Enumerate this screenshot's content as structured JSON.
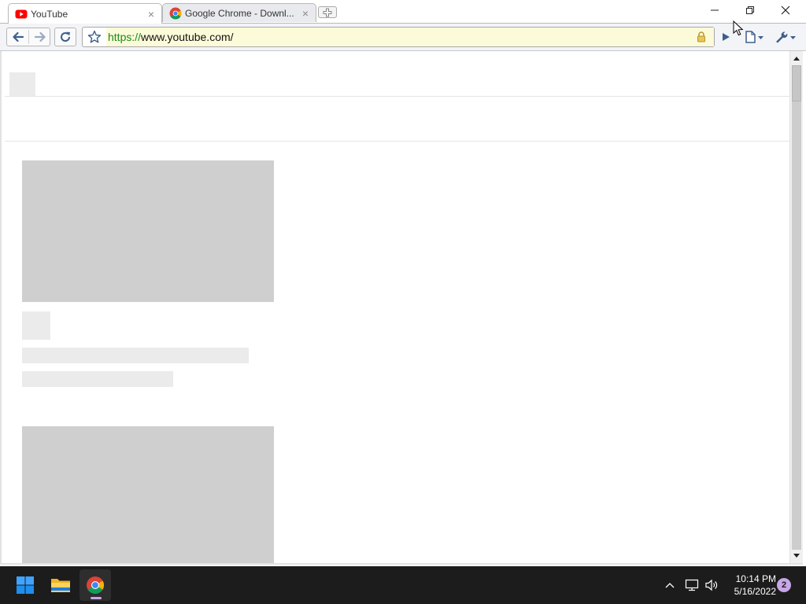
{
  "browser": {
    "tabs": [
      {
        "title": "YouTube",
        "favicon": "youtube-icon",
        "active": true
      },
      {
        "title": "Google Chrome - Downl...",
        "favicon": "chrome-icon",
        "active": false
      }
    ],
    "new_tab": "new-tab-icon",
    "window_controls": [
      "minimize-icon",
      "restore-icon",
      "close-icon"
    ],
    "toolbar": {
      "back": "back-arrow-icon",
      "forward": "forward-arrow-icon",
      "reload": "reload-icon",
      "bookmark": "star-icon",
      "url_scheme": "https://",
      "url_rest": "www.youtube.com/",
      "secure": "lock-icon",
      "page_menu": "page-icon",
      "settings_menu": "wrench-icon"
    }
  },
  "taskbar": {
    "apps": [
      "windows-start-icon",
      "file-explorer-icon",
      "chrome-icon"
    ],
    "tray": [
      "chevron-up-icon",
      "network-icon",
      "volume-icon"
    ],
    "time": "10:14 PM",
    "date": "5/16/2022",
    "notifications": "2"
  },
  "colors": {
    "taskbar": "#1c1c1c",
    "skeleton": "#cfcfcf",
    "skeleton_light": "#ebebeb",
    "url_highlight": "#fcfbd9",
    "secure_scheme": "#1a8a1a",
    "youtube_red": "#ff0000",
    "notification_badge": "#c7a6e8"
  }
}
